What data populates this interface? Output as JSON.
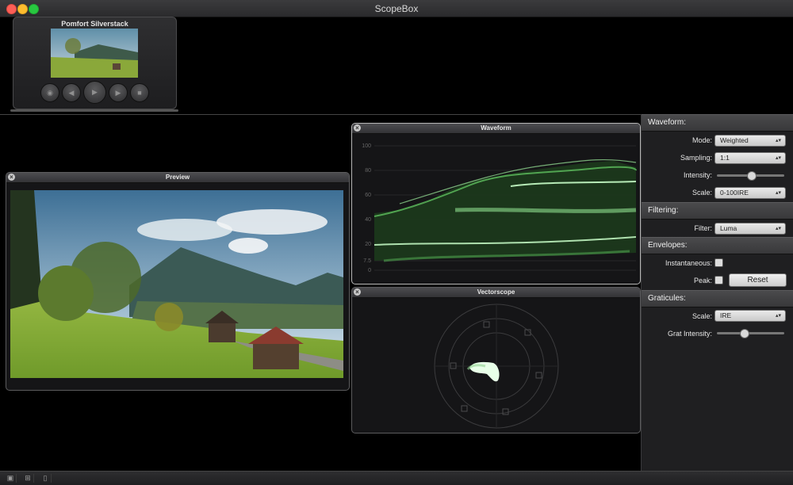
{
  "window": {
    "title": "ScopeBox"
  },
  "source": {
    "title": "Pomfort Silverstack",
    "controls": {
      "snapshot": "camera-icon",
      "prev": "skip-back-icon",
      "play": "play-icon",
      "next": "skip-forward-icon",
      "stop": "stop-icon"
    }
  },
  "preview": {
    "title": "Preview"
  },
  "waveform": {
    "title": "Waveform",
    "scale_labels": [
      "100",
      "80",
      "60",
      "40",
      "20",
      "7.5",
      "0"
    ]
  },
  "vectorscope": {
    "title": "Vectorscope"
  },
  "inspector": {
    "waveform_section": "Waveform:",
    "mode_label": "Mode:",
    "mode_value": "Weighted",
    "sampling_label": "Sampling:",
    "sampling_value": "1:1",
    "intensity_label": "Intensity:",
    "intensity_level": 0.5,
    "scale_label": "Scale:",
    "scale_value": "0-100IRE",
    "filtering_section": "Filtering:",
    "filter_label": "Filter:",
    "filter_value": "Luma",
    "envelopes_section": "Envelopes:",
    "instantaneous_label": "Instantaneous:",
    "peak_label": "Peak:",
    "reset_label": "Reset",
    "graticules_section": "Graticules:",
    "grat_scale_label": "Scale:",
    "grat_scale_value": "IRE",
    "grat_intensity_label": "Grat Intensity:",
    "grat_intensity_level": 0.4
  },
  "colors": {
    "accent_green": "#7fe07f",
    "panel_bg": "#151517",
    "inspector_bg": "#1f1f21"
  }
}
